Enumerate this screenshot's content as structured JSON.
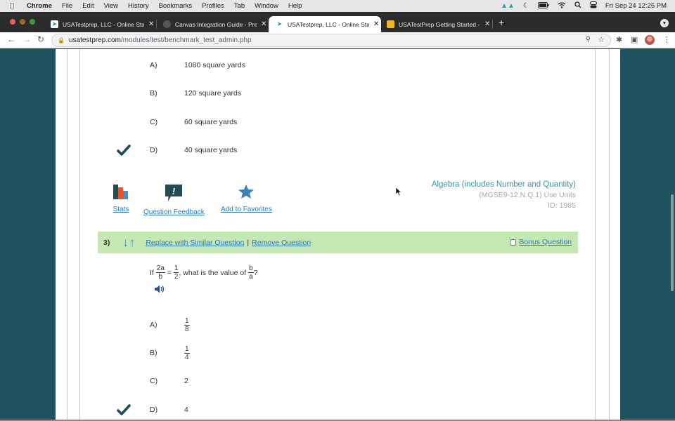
{
  "menubar": {
    "app": "Chrome",
    "items": [
      "File",
      "Edit",
      "View",
      "History",
      "Bookmarks",
      "Profiles",
      "Tab",
      "Window",
      "Help"
    ],
    "clock": "Fri Sep 24  12:25 PM"
  },
  "tabs": [
    {
      "title": "USATestprep, LLC - Online Sta",
      "active": false,
      "icon": "usatestprep-cursor-icon"
    },
    {
      "title": "Canvas Integration Guide - Pre",
      "active": false,
      "icon": "globe-icon"
    },
    {
      "title": "USATestprep, LLC - Online Sta",
      "active": true,
      "icon": "usatestprep-cursor-icon"
    },
    {
      "title": "USATestPrep Getting Started -",
      "active": false,
      "icon": "slides-icon"
    }
  ],
  "address_bar": {
    "host": "usatestprep.com",
    "path": "/modules/test/benchmark_test_admin.php"
  },
  "question2": {
    "choices": [
      {
        "letter": "A)",
        "text": "1080 square yards",
        "correct": false
      },
      {
        "letter": "B)",
        "text": "120 square yards",
        "correct": false
      },
      {
        "letter": "C)",
        "text": "60 square yards",
        "correct": false
      },
      {
        "letter": "D)",
        "text": "40 square yards",
        "correct": true
      }
    ],
    "actions": {
      "stats": "Stats",
      "feedback": "Question Feedback",
      "favorites": "Add to Favorites"
    },
    "meta": {
      "subject": "Algebra (includes Number and Quantity)",
      "standard": "(MGSE9-12.N.Q.1) Use Units",
      "id": "ID: 1985"
    }
  },
  "question3": {
    "number": "3)",
    "replace_label": "Replace with Similar Question",
    "separator": "|",
    "remove_label": "Remove Question",
    "bonus_label": "Bonus Question",
    "bonus_checked": false,
    "stem": {
      "prefix": "If",
      "lhs_num": "2a",
      "lhs_den": "b",
      "equals": "=",
      "rhs_num": "1",
      "rhs_den": "2",
      "middle": ", what is the value of",
      "q_num": "b",
      "q_den": "a",
      "suffix": "?"
    },
    "choices": [
      {
        "letter": "A)",
        "num": "1",
        "den": "8",
        "correct": false
      },
      {
        "letter": "B)",
        "num": "1",
        "den": "4",
        "correct": false
      },
      {
        "letter": "C)",
        "text": "2",
        "correct": false
      },
      {
        "letter": "D)",
        "text": "4",
        "correct": true
      }
    ]
  },
  "colors": {
    "page_bg": "#1f5360",
    "qbar_green": "#c5e7b4",
    "link_blue": "#2b7bb9",
    "subject_teal": "#3a96a8",
    "check_dark": "#234c56"
  }
}
